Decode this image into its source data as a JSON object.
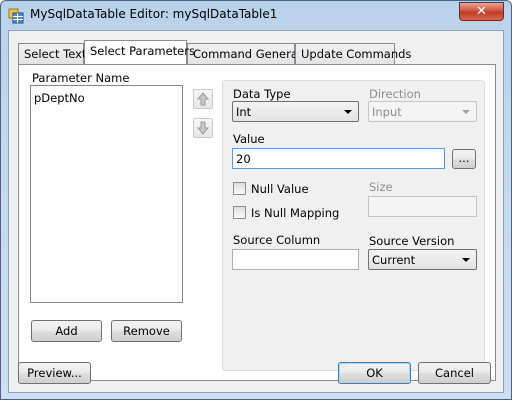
{
  "window": {
    "title": "MySqlDataTable Editor: mySqlDataTable1",
    "close_glyph": "✕"
  },
  "tabs": [
    {
      "label": "Select Text",
      "active": false
    },
    {
      "label": "Select Parameters",
      "active": true
    },
    {
      "label": "Command Generator",
      "active": false
    },
    {
      "label": "Update Commands",
      "active": false
    }
  ],
  "parameters": {
    "list_header": "Parameter Name",
    "items": [
      "pDeptNo"
    ],
    "add_label": "Add",
    "remove_label": "Remove"
  },
  "details": {
    "data_type_label": "Data Type",
    "data_type_value": "Int",
    "direction_label": "Direction",
    "direction_value": "Input",
    "value_label": "Value",
    "value_text": "20",
    "browse_label": "...",
    "null_value_label": "Null Value",
    "null_value_checked": false,
    "size_label": "Size",
    "size_value": "",
    "is_null_mapping_label": "Is Null Mapping",
    "is_null_mapping_checked": false,
    "source_column_label": "Source Column",
    "source_column_value": "",
    "source_version_label": "Source Version",
    "source_version_value": "Current"
  },
  "footer": {
    "preview_label": "Preview...",
    "ok_label": "OK",
    "cancel_label": "Cancel"
  },
  "colors": {
    "title_bar": "#c4d8ee",
    "close_button": "#c13b25",
    "focus_border": "#5a9bd5",
    "default_button_border": "#3c7fb1"
  },
  "icons": {
    "move_up": "arrow-up-icon",
    "move_down": "arrow-down-icon",
    "app": "table-editor-icon"
  }
}
